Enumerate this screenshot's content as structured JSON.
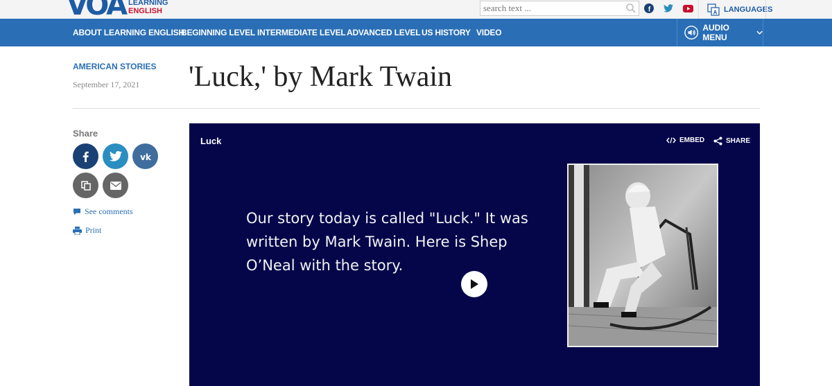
{
  "header": {
    "logo_mark": "VOA",
    "logo_line1": "LEARNING",
    "logo_line2": "ENGLISH",
    "search_placeholder": "search text ...",
    "languages_label": "LANGUAGES"
  },
  "nav": {
    "items": [
      {
        "label": "ABOUT LEARNING ENGLISH"
      },
      {
        "label": "BEGINNING LEVEL"
      },
      {
        "label": "INTERMEDIATE LEVEL"
      },
      {
        "label": "ADVANCED LEVEL"
      },
      {
        "label": "US HISTORY"
      },
      {
        "label": "VIDEO"
      }
    ],
    "audio_menu_label": "AUDIO MENU"
  },
  "article": {
    "category": "AMERICAN STORIES",
    "date": "September 17, 2021",
    "title": "'Luck,' by Mark Twain"
  },
  "sidebar": {
    "share_label": "Share",
    "see_comments": "See comments",
    "print": "Print"
  },
  "video": {
    "title": "Luck",
    "embed_label": "EMBED",
    "share_label": "SHARE",
    "caption": "Our story today is called \"Luck.\"  It was written by Mark Twain. Here is Shep O’Neal with the story."
  },
  "colors": {
    "brand_blue": "#2a6eb5",
    "logo_blue": "#1d5ba5",
    "logo_red": "#c8102e",
    "facebook": "#1a4174",
    "twitter": "#2a8ec1",
    "vk": "#3f6d9e",
    "copy": "#666666",
    "email": "#666666",
    "video_bg": "#05064a"
  },
  "icons": [
    "search-icon",
    "facebook-icon",
    "twitter-icon",
    "youtube-icon",
    "languages-icon",
    "audio-icon",
    "chevron-down-icon",
    "vk-icon",
    "copy-icon",
    "email-icon",
    "comment-icon",
    "print-icon",
    "embed-icon",
    "share-icon",
    "play-icon"
  ]
}
